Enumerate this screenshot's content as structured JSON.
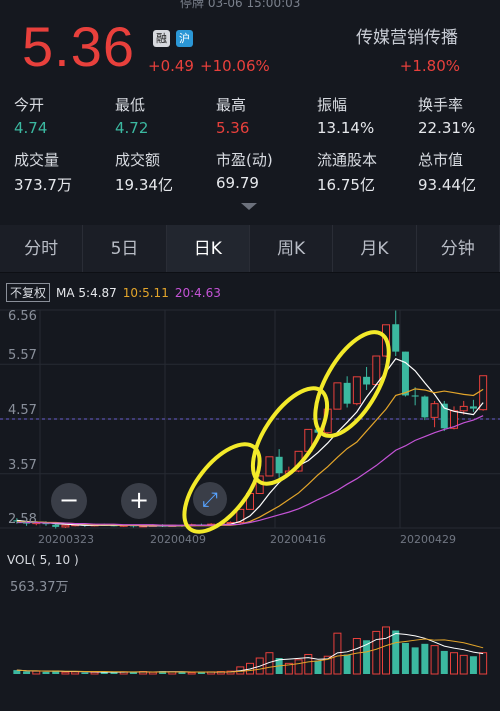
{
  "status": {
    "text": "停牌 03-06 15:00:03"
  },
  "quote": {
    "price": "5.36",
    "badge_rong": "融",
    "badge_sh": "沪",
    "change": "+0.49",
    "change_pct": "+10.06%",
    "sector": "传媒营销传播",
    "sector_arrow": "›",
    "sector_pct": "+1.80%"
  },
  "stats": [
    {
      "label": "今开",
      "value": "4.74",
      "color": "#3bb8a0"
    },
    {
      "label": "最低",
      "value": "4.72",
      "color": "#3bb8a0"
    },
    {
      "label": "最高",
      "value": "5.36",
      "color": "#e8403c"
    },
    {
      "label": "振幅",
      "value": "13.14%",
      "color": "#e6e8ec"
    },
    {
      "label": "换手率",
      "value": "22.31%",
      "color": "#e6e8ec"
    },
    {
      "label": "成交量",
      "value": "373.7万",
      "color": "#e6e8ec"
    },
    {
      "label": "成交额",
      "value": "19.34亿",
      "color": "#e6e8ec"
    },
    {
      "label": "市盈(动)",
      "value": "69.79",
      "color": "#e6e8ec"
    },
    {
      "label": "流通股本",
      "value": "16.75亿",
      "color": "#e6e8ec"
    },
    {
      "label": "总市值",
      "value": "93.44亿",
      "color": "#e6e8ec"
    }
  ],
  "tabs": [
    {
      "label": "分时",
      "active": false
    },
    {
      "label": "5日",
      "active": false
    },
    {
      "label": "日K",
      "active": true
    },
    {
      "label": "周K",
      "active": false
    },
    {
      "label": "月K",
      "active": false
    },
    {
      "label": "分钟",
      "active": false
    }
  ],
  "legend": {
    "fq": "不复权",
    "ma5": "MA 5:4.87",
    "ma10": "10:5.11",
    "ma20": "20:4.63"
  },
  "zoom": {
    "minus": "−",
    "plus": "+",
    "expand": "⤢"
  },
  "vol_legend": "VOL( 5, 10 )",
  "vol_max": "563.37万",
  "chart_data": {
    "type": "candlestick",
    "y_ticks": [
      "6.56",
      "5.57",
      "4.57",
      "3.57",
      "2.58"
    ],
    "ylim": [
      2.58,
      6.56
    ],
    "reference_line": 4.57,
    "x_labels": [
      "20200323",
      "20200409",
      "20200416",
      "20200429"
    ],
    "candles": [
      [
        2.72,
        2.7,
        2.76,
        2.66
      ],
      [
        2.7,
        2.66,
        2.72,
        2.62
      ],
      [
        2.66,
        2.68,
        2.7,
        2.63
      ],
      [
        2.68,
        2.65,
        2.7,
        2.62
      ],
      [
        2.64,
        2.6,
        2.66,
        2.57
      ],
      [
        2.6,
        2.63,
        2.65,
        2.58
      ],
      [
        2.63,
        2.64,
        2.66,
        2.61
      ],
      [
        2.64,
        2.62,
        2.66,
        2.6
      ],
      [
        2.62,
        2.64,
        2.66,
        2.61
      ],
      [
        2.64,
        2.63,
        2.66,
        2.62
      ],
      [
        2.63,
        2.62,
        2.65,
        2.61
      ],
      [
        2.62,
        2.63,
        2.64,
        2.6
      ],
      [
        2.63,
        2.61,
        2.64,
        2.59
      ],
      [
        2.61,
        2.62,
        2.64,
        2.6
      ],
      [
        2.62,
        2.63,
        2.65,
        2.61
      ],
      [
        2.63,
        2.62,
        2.65,
        2.6
      ],
      [
        2.62,
        2.63,
        2.64,
        2.61
      ],
      [
        2.63,
        2.62,
        2.64,
        2.6
      ],
      [
        2.62,
        2.64,
        2.66,
        2.61
      ],
      [
        2.64,
        2.63,
        2.66,
        2.62
      ],
      [
        2.63,
        2.65,
        2.67,
        2.62
      ],
      [
        2.65,
        2.66,
        2.68,
        2.63
      ],
      [
        2.66,
        2.68,
        2.7,
        2.64
      ],
      [
        2.68,
        2.92,
        2.92,
        2.66
      ],
      [
        2.92,
        3.21,
        3.21,
        2.92
      ],
      [
        3.21,
        3.53,
        3.53,
        3.21
      ],
      [
        3.53,
        3.88,
        3.88,
        3.53
      ],
      [
        3.88,
        3.58,
        4.02,
        3.5
      ],
      [
        3.58,
        3.62,
        3.7,
        3.55
      ],
      [
        3.62,
        3.98,
        3.98,
        3.6
      ],
      [
        3.98,
        4.38,
        4.38,
        3.98
      ],
      [
        4.38,
        4.32,
        4.45,
        4.2
      ],
      [
        4.32,
        4.75,
        4.75,
        4.3
      ],
      [
        4.75,
        5.23,
        5.23,
        4.75
      ],
      [
        5.23,
        4.85,
        5.35,
        4.78
      ],
      [
        4.85,
        5.34,
        5.34,
        4.82
      ],
      [
        5.34,
        5.2,
        5.52,
        5.1
      ],
      [
        5.2,
        5.72,
        5.72,
        5.18
      ],
      [
        5.72,
        6.29,
        6.29,
        5.7
      ],
      [
        6.3,
        5.8,
        6.55,
        5.72
      ],
      [
        5.8,
        5.0,
        5.8,
        4.98
      ],
      [
        5.0,
        4.98,
        5.15,
        4.82
      ],
      [
        4.98,
        4.6,
        5.0,
        4.55
      ],
      [
        4.6,
        4.85,
        4.9,
        4.42
      ],
      [
        4.85,
        4.4,
        4.9,
        4.35
      ],
      [
        4.4,
        4.72,
        4.8,
        4.38
      ],
      [
        4.72,
        4.8,
        4.9,
        4.65
      ],
      [
        4.8,
        4.76,
        4.92,
        4.7
      ],
      [
        4.74,
        5.36,
        5.36,
        4.72
      ]
    ],
    "ma5": [
      2.72,
      2.7,
      2.69,
      2.68,
      2.66,
      2.65,
      2.64,
      2.63,
      2.63,
      2.63,
      2.63,
      2.63,
      2.63,
      2.62,
      2.62,
      2.62,
      2.62,
      2.62,
      2.63,
      2.63,
      2.63,
      2.64,
      2.65,
      2.7,
      2.8,
      2.98,
      3.21,
      3.41,
      3.56,
      3.72,
      3.81,
      3.96,
      4.13,
      4.33,
      4.51,
      4.7,
      4.97,
      5.2,
      5.43,
      5.67,
      5.6,
      5.45,
      5.23,
      5.02,
      4.77,
      4.71,
      4.68,
      4.65,
      4.87
    ],
    "ma10": [
      2.7,
      2.69,
      2.69,
      2.68,
      2.68,
      2.67,
      2.66,
      2.65,
      2.64,
      2.64,
      2.64,
      2.63,
      2.63,
      2.63,
      2.63,
      2.63,
      2.63,
      2.62,
      2.62,
      2.62,
      2.62,
      2.63,
      2.63,
      2.65,
      2.7,
      2.78,
      2.88,
      2.98,
      3.1,
      3.22,
      3.38,
      3.55,
      3.7,
      3.87,
      4.03,
      4.15,
      4.35,
      4.55,
      4.75,
      5.0,
      5.05,
      5.12,
      5.1,
      5.05,
      5.08,
      5.05,
      5.02,
      5.0,
      5.11
    ],
    "ma20": [
      2.68,
      2.68,
      2.68,
      2.67,
      2.67,
      2.67,
      2.66,
      2.66,
      2.65,
      2.65,
      2.65,
      2.64,
      2.64,
      2.64,
      2.64,
      2.63,
      2.63,
      2.63,
      2.63,
      2.63,
      2.63,
      2.64,
      2.64,
      2.65,
      2.68,
      2.72,
      2.77,
      2.82,
      2.87,
      2.93,
      3.01,
      3.1,
      3.18,
      3.27,
      3.38,
      3.48,
      3.6,
      3.72,
      3.86,
      4.0,
      4.08,
      4.18,
      4.25,
      4.32,
      4.38,
      4.43,
      4.5,
      4.55,
      4.63
    ],
    "volume": [
      22,
      14,
      16,
      12,
      20,
      10,
      12,
      8,
      10,
      14,
      10,
      12,
      10,
      14,
      10,
      16,
      12,
      10,
      8,
      10,
      12,
      14,
      16,
      40,
      60,
      90,
      120,
      90,
      60,
      80,
      110,
      75,
      100,
      230,
      110,
      200,
      190,
      240,
      265,
      245,
      175,
      150,
      170,
      160,
      130,
      120,
      105,
      100,
      120
    ],
    "vol_max": 563.37
  }
}
